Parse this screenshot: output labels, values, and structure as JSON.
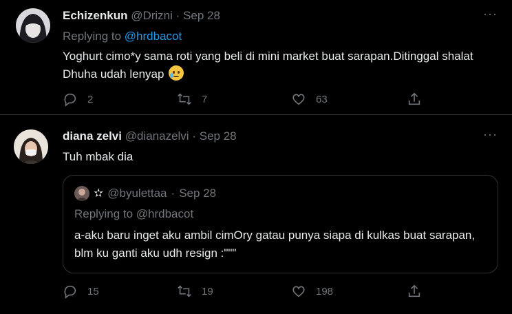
{
  "tweets": [
    {
      "name": "Echizenkun",
      "handle": "@Drizni",
      "separator": "·",
      "date": "Sep 28",
      "more": "···",
      "replying_prefix": "Replying to ",
      "replying_to": "@hrdbacot",
      "text": "Yoghurt cimo*y sama roti yang beli di mini market buat sarapan.Ditinggal shalat Dhuha  udah lenyap",
      "replies": "2",
      "retweets": "7",
      "likes": "63"
    },
    {
      "name": "diana zelvi",
      "handle": "@dianazelvi",
      "separator": "·",
      "date": "Sep 28",
      "more": "···",
      "text": "Tuh mbak dia",
      "replies": "15",
      "retweets": "19",
      "likes": "198",
      "quote": {
        "star": "✫",
        "handle": "@byulettaa",
        "separator": "·",
        "date": "Sep 28",
        "replying": "Replying to @hrdbacot",
        "text": "a-aku baru inget aku ambil cimOry gatau punya siapa di kulkas buat sarapan, blm ku ganti aku udh resign :\"\"\""
      }
    }
  ],
  "icons": {
    "reply": "reply-icon",
    "retweet": "retweet-icon",
    "like": "heart-icon",
    "share": "share-icon",
    "emoji": "sad-tear-emoji"
  },
  "colors": {
    "background": "#000000",
    "mention": "#1d9bf0",
    "muted": "#71767b",
    "text": "#e7e9ea",
    "border": "#2f3336"
  }
}
